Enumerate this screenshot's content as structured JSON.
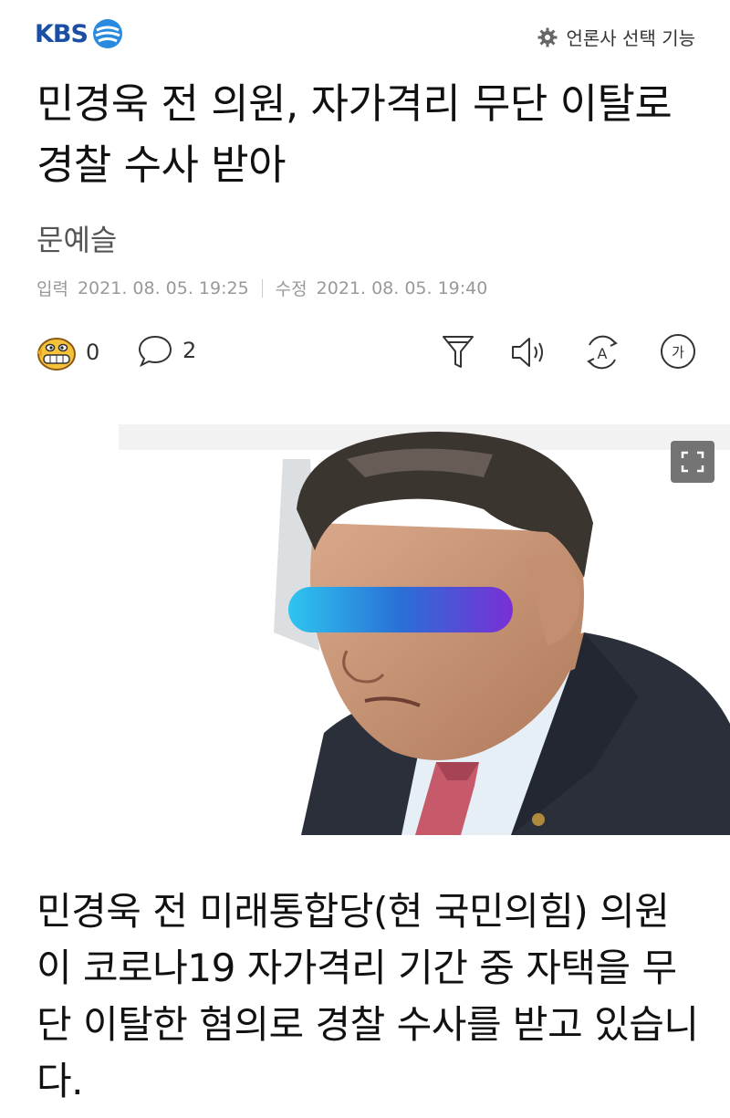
{
  "header": {
    "logo_text": "KBS",
    "press_select_label": "언론사 선택 기능",
    "brand_color": "#1a4fa3"
  },
  "article": {
    "headline": "민경욱 전 의원, 자가격리 무단 이탈로 경찰 수사 받아",
    "reporter": "문예슬",
    "input_label": "입력",
    "input_date": "2021. 08. 05. 19:25",
    "modified_label": "수정",
    "modified_date": "2021. 08. 05. 19:40",
    "body": "민경욱 전 미래통합당(현 국민의힘) 의원이 코로나19 자가격리 기간 중 자택을 무단 이탈한 혐의로 경찰 수사를 받고 있습니다."
  },
  "actions": {
    "reaction_count": "0",
    "comment_count": "2",
    "icons": [
      "reaction-emoji-icon",
      "comment-icon",
      "summary-filter-icon",
      "read-aloud-icon",
      "translate-icon",
      "font-size-icon"
    ]
  },
  "photo": {
    "censor_bar_gradient": [
      "#2ec5f0",
      "#2a6fd6",
      "#7a2fd6"
    ],
    "expand_icon": "fullscreen-icon"
  }
}
